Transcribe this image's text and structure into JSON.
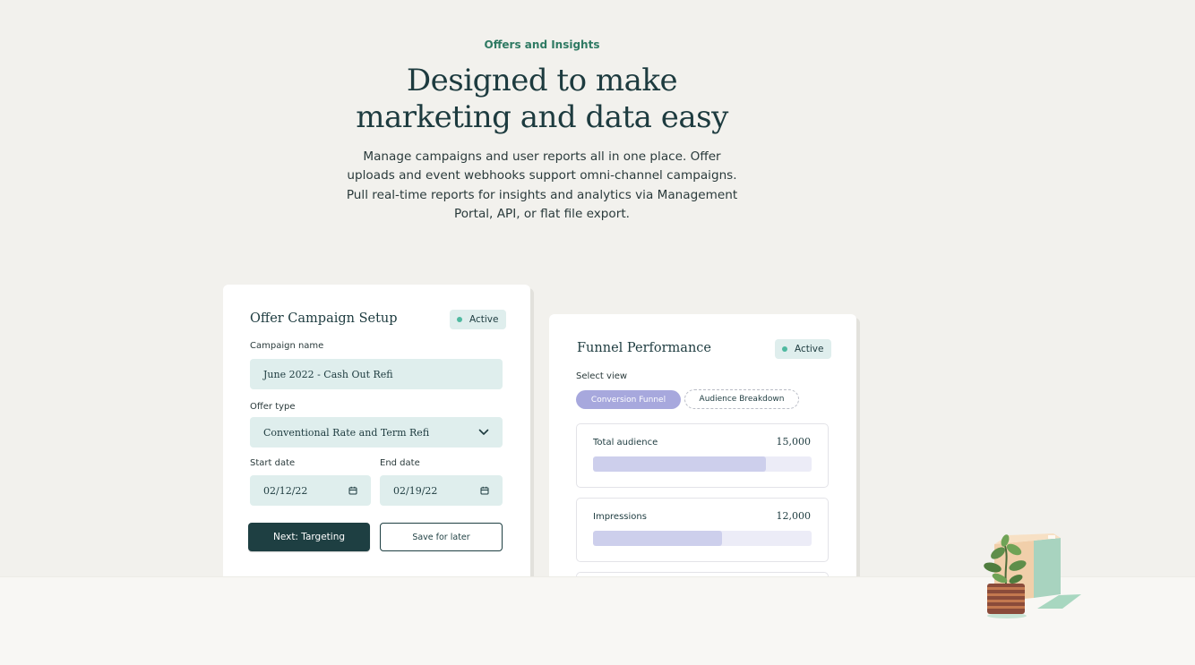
{
  "hero": {
    "eyebrow": "Offers and Insights",
    "headline_line1": "Designed to make",
    "headline_line2": "marketing and data easy",
    "subtext": "Manage campaigns and user reports all in one place. Offer uploads and event webhooks support omni-channel campaigns. Pull real-time reports for insights and analytics via Management Portal, API, or flat file export."
  },
  "setup_card": {
    "title": "Offer Campaign Setup",
    "status": "Active",
    "campaign_name_label": "Campaign name",
    "campaign_name_value": "June 2022 - Cash Out Refi",
    "offer_type_label": "Offer type",
    "offer_type_value": "Conventional Rate and Term Refi",
    "start_date_label": "Start date",
    "start_date_value": "02/12/22",
    "end_date_label": "End date",
    "end_date_value": "02/19/22",
    "next_button": "Next: Targeting",
    "save_button": "Save for later"
  },
  "funnel_card": {
    "title": "Funnel Performance",
    "status": "Active",
    "select_view_label": "Select view",
    "view_options": [
      "Conversion Funnel",
      "Audience Breakdown"
    ],
    "selected_view": "Conversion Funnel",
    "metrics": [
      {
        "name": "Total audience",
        "value": "15,000",
        "fraction": 0.79
      },
      {
        "name": "Impressions",
        "value": "12,000",
        "fraction": 0.59
      }
    ]
  },
  "colors": {
    "accent_green": "#2f7a63",
    "dark_teal": "#1e3f42",
    "field_bg": "#dfeeed",
    "status_dot": "#4fb9a0",
    "pill_purple": "#a7a8dd",
    "bar_fill": "#cdcfec"
  },
  "icons": [
    "chevron-down-icon",
    "calendar-icon",
    "plant-illustration"
  ]
}
